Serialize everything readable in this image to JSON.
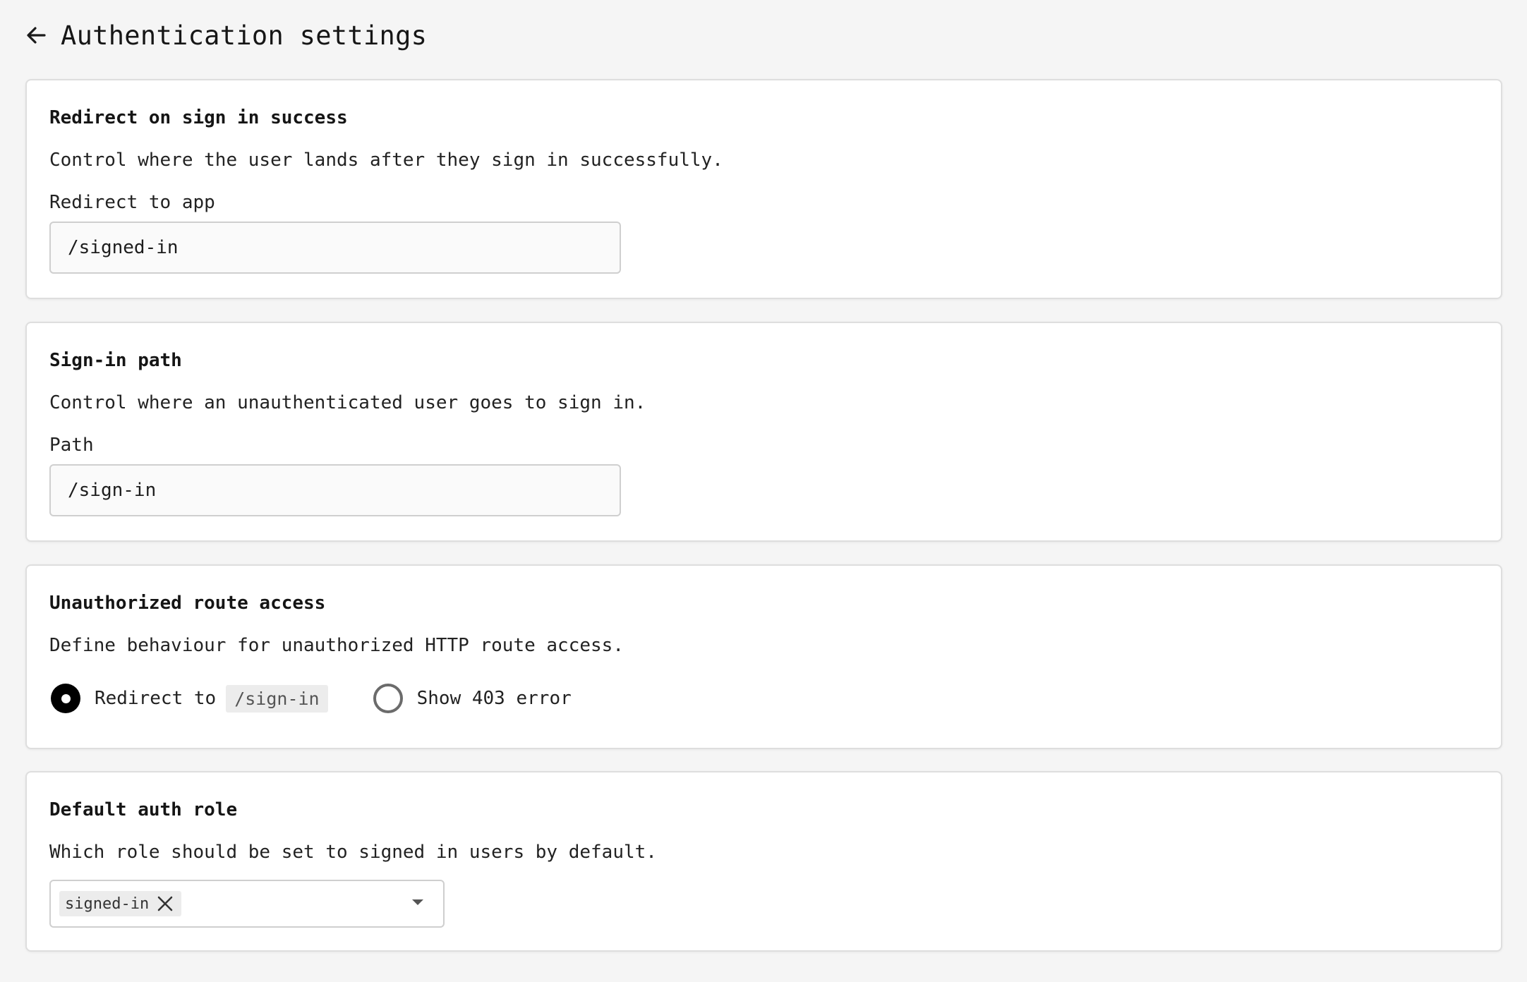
{
  "header": {
    "title": "Authentication settings",
    "back_icon": "arrow-left-icon"
  },
  "sections": [
    {
      "title": "Redirect on sign in success",
      "description": "Control where the user lands after they sign in successfully.",
      "field_label": "Redirect to app",
      "input_value": "/signed-in"
    },
    {
      "title": "Sign-in path",
      "description": "Control where an unauthenticated user goes to sign in.",
      "field_label": "Path",
      "input_value": "/sign-in"
    },
    {
      "title": "Unauthorized route access",
      "description": "Define behaviour for unauthorized HTTP route access.",
      "options": [
        {
          "label": "Redirect to",
          "code": "/sign-in",
          "selected": true
        },
        {
          "label": "Show 403 error",
          "selected": false
        }
      ]
    },
    {
      "title": "Default auth role",
      "description": "Which role should be set to signed in users by default.",
      "selected_roles": [
        "signed-in"
      ],
      "remove_icon": "close-icon",
      "dropdown_icon": "caret-down-icon"
    }
  ]
}
